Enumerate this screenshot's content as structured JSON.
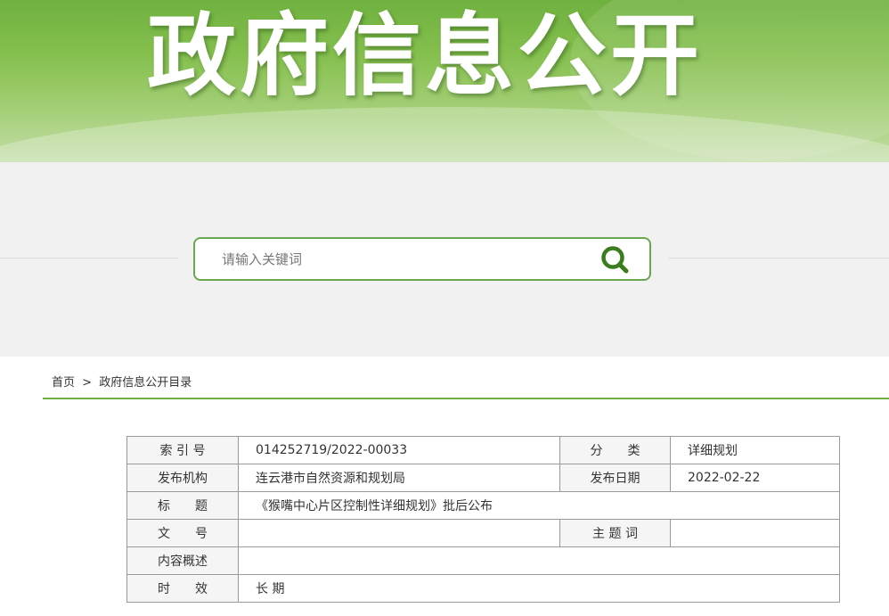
{
  "banner": {
    "title": "政府信息公开"
  },
  "search": {
    "placeholder": "请输入关键词",
    "value": ""
  },
  "breadcrumb": {
    "home": "首页",
    "separator": ">",
    "current": "政府信息公开目录"
  },
  "info_table": {
    "index_label": "索 引 号",
    "index_value": "014252719/2022-00033",
    "category_label": "分　　类",
    "category_value": "详细规划",
    "publisher_label": "发布机构",
    "publisher_value": "连云港市自然资源和规划局",
    "date_label": "发布日期",
    "date_value": "2022-02-22",
    "title_label": "标　　题",
    "title_value": "《猴嘴中心片区控制性详细规划》批后公布",
    "docno_label": "文　　号",
    "docno_value": "",
    "keywords_label": "主 题 词",
    "keywords_value": "",
    "summary_label": "内容概述",
    "summary_value": "",
    "validity_label": "时　　效",
    "validity_value": "长 期"
  },
  "colors": {
    "accent": "#6fb13f",
    "search_border": "#6aa84f",
    "search_icon": "#3a7d1f"
  },
  "icons": {
    "search": "search-icon"
  }
}
